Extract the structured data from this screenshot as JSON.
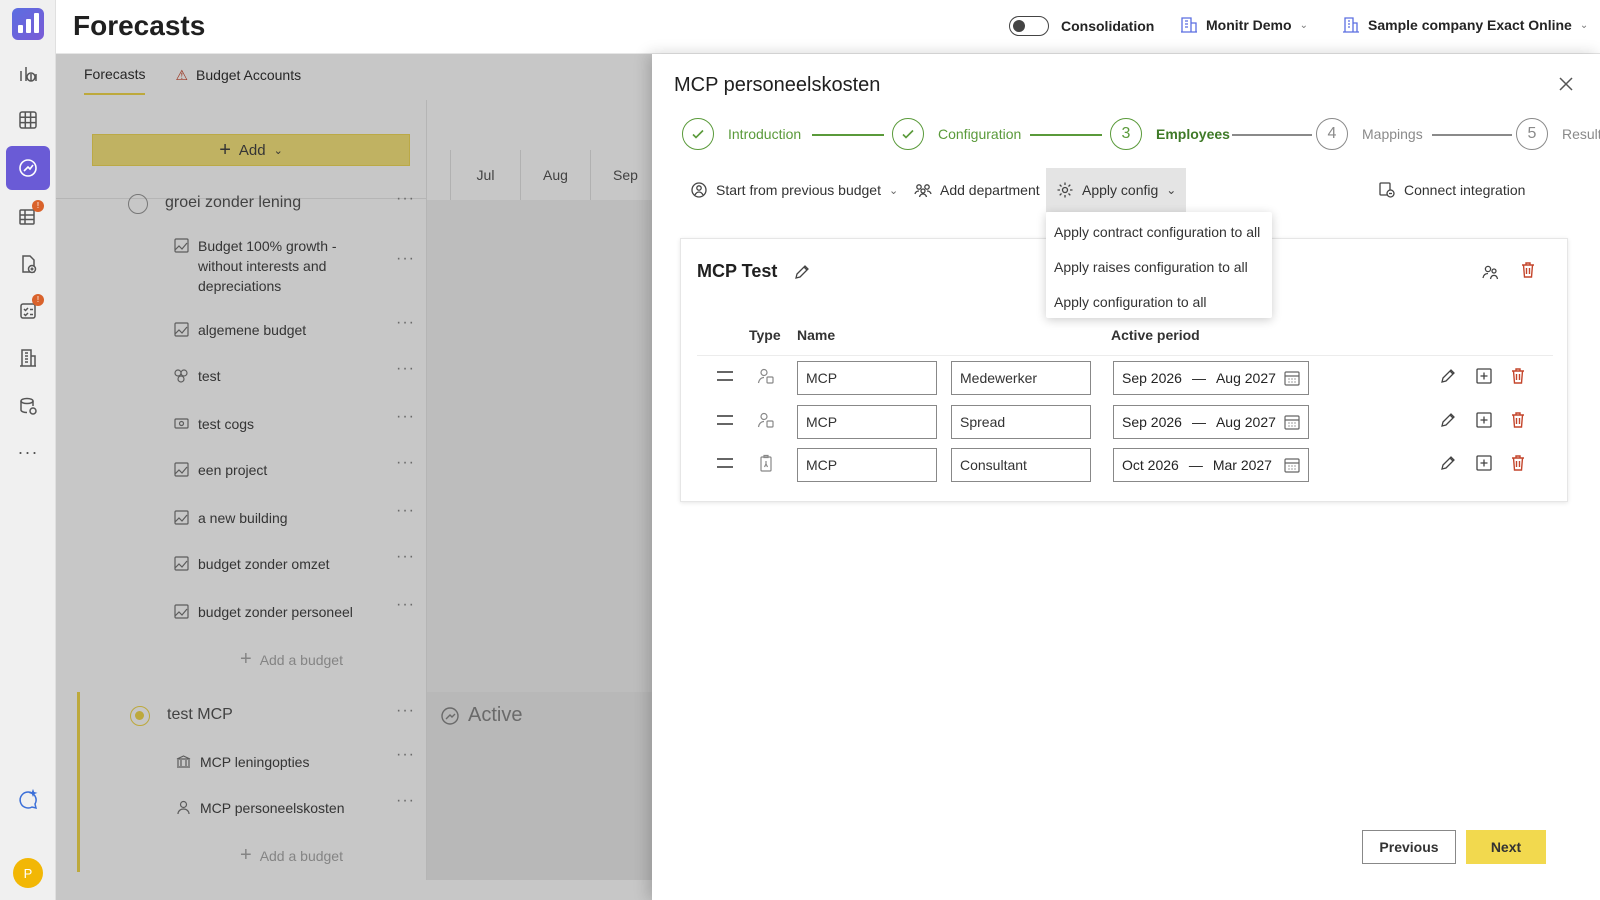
{
  "header": {
    "title": "Forecasts",
    "consolidation_label": "Consolidation",
    "consolidation_on": false,
    "workspace": "Monitr Demo",
    "company": "Sample company Exact Online"
  },
  "rail": {
    "avatar_initial": "P"
  },
  "subtabs": {
    "forecasts": "Forecasts",
    "budget_accounts": "Budget Accounts"
  },
  "list": {
    "add_label": "Add",
    "group1_title": "groei zonder lening",
    "group1_budgets": [
      "Budget 100% growth - without interests and depreciations",
      "algemene budget",
      "test",
      "test cogs",
      "een project",
      "a new building",
      "budget zonder omzet",
      "budget zonder personeel"
    ],
    "add_budget_label": "Add a budget",
    "group2_title": "test MCP",
    "group2_budgets": [
      "MCP leningopties",
      "MCP personeelskosten"
    ]
  },
  "calendar": {
    "months": [
      "Jul",
      "Aug",
      "Sep"
    ],
    "active_label": "Active"
  },
  "panel": {
    "title": "MCP personeelskosten",
    "steps": [
      {
        "label": "Introduction",
        "state": "done"
      },
      {
        "num": "3",
        "label": "Employees",
        "state": "current"
      },
      {
        "num": "4",
        "label": "Mappings",
        "state": "todo"
      },
      {
        "num": "5",
        "label": "Result",
        "state": "todo"
      }
    ],
    "step2_label": "Configuration",
    "toolbar": {
      "start_prev": "Start from previous budget",
      "add_dept": "Add department",
      "apply_config": "Apply config",
      "connect": "Connect integration"
    },
    "dropdown": [
      "Apply contract configuration to all",
      "Apply raises configuration to all",
      "Apply configuration to all"
    ],
    "card": {
      "title": "MCP Test",
      "columns": {
        "type": "Type",
        "name": "Name",
        "period": "Active period"
      },
      "rows": [
        {
          "name": "MCP",
          "role": "Medewerker",
          "start": "Sep 2026",
          "end": "Aug 2027"
        },
        {
          "name": "MCP",
          "role": "Spread",
          "start": "Sep 2026",
          "end": "Aug 2027"
        },
        {
          "name": "MCP",
          "role": "Consultant",
          "start": "Oct 2026",
          "end": "Mar 2027"
        }
      ],
      "dash": "—"
    },
    "buttons": {
      "previous": "Previous",
      "next": "Next"
    }
  }
}
